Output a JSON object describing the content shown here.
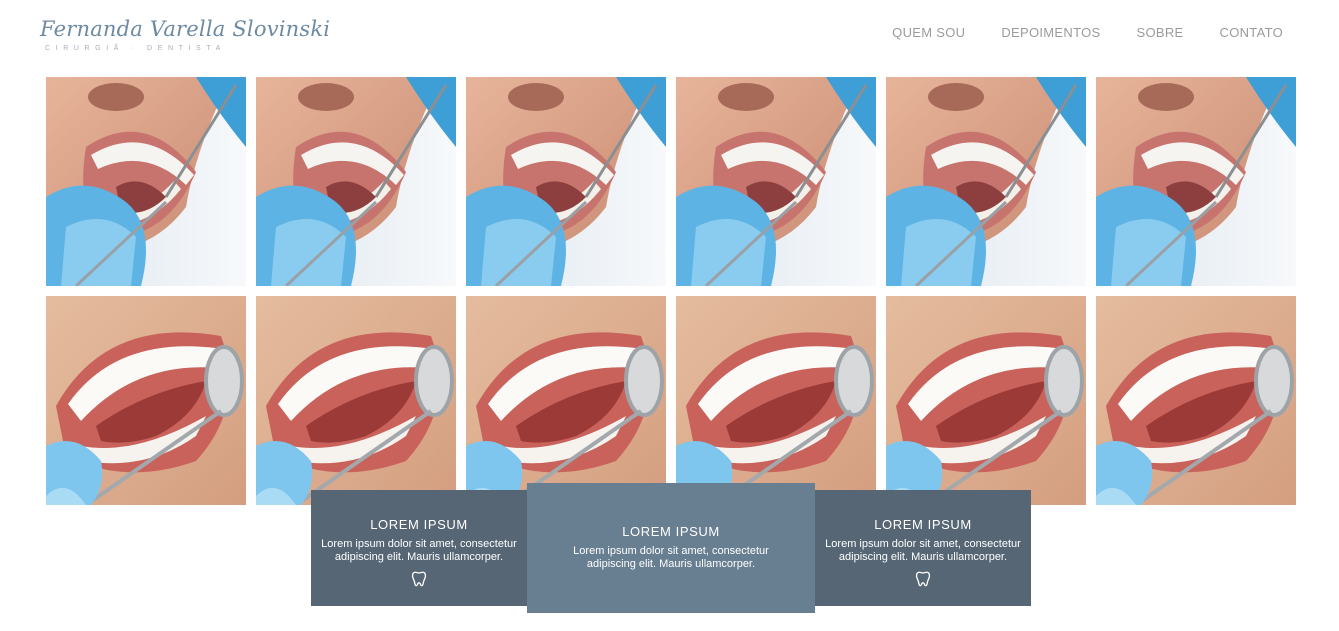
{
  "brand": {
    "name": "Fernanda Varella Slovinski",
    "subtitle": "CIRURGIÃ · DENTISTA"
  },
  "nav": {
    "items": [
      {
        "label": "QUEM SOU"
      },
      {
        "label": "DEPOIMENTOS"
      },
      {
        "label": "SOBRE"
      },
      {
        "label": "CONTATO"
      }
    ]
  },
  "gallery": {
    "rows": [
      {
        "image": "dental-exam-mirror-photo",
        "count": 6
      },
      {
        "image": "smile-mirror-photo",
        "count": 6
      }
    ]
  },
  "cards": [
    {
      "title": "LOREM IPSUM",
      "text": "Lorem ipsum dolor sit amet, consectetur adipiscing elit. Mauris ullamcorper.",
      "icon": "tooth-icon"
    },
    {
      "title": "LOREM IPSUM",
      "text": "Lorem ipsum dolor sit amet, consectetur adipiscing elit. Mauris ullamcorper."
    },
    {
      "title": "LOREM IPSUM",
      "text": "Lorem ipsum dolor sit amet, consectetur adipiscing elit. Mauris ullamcorper.",
      "icon": "tooth-icon"
    }
  ],
  "colors": {
    "card_dark": "#566674",
    "card_light": "#687e91",
    "logo": "#6d8aa3",
    "nav": "#9b9b9b"
  }
}
